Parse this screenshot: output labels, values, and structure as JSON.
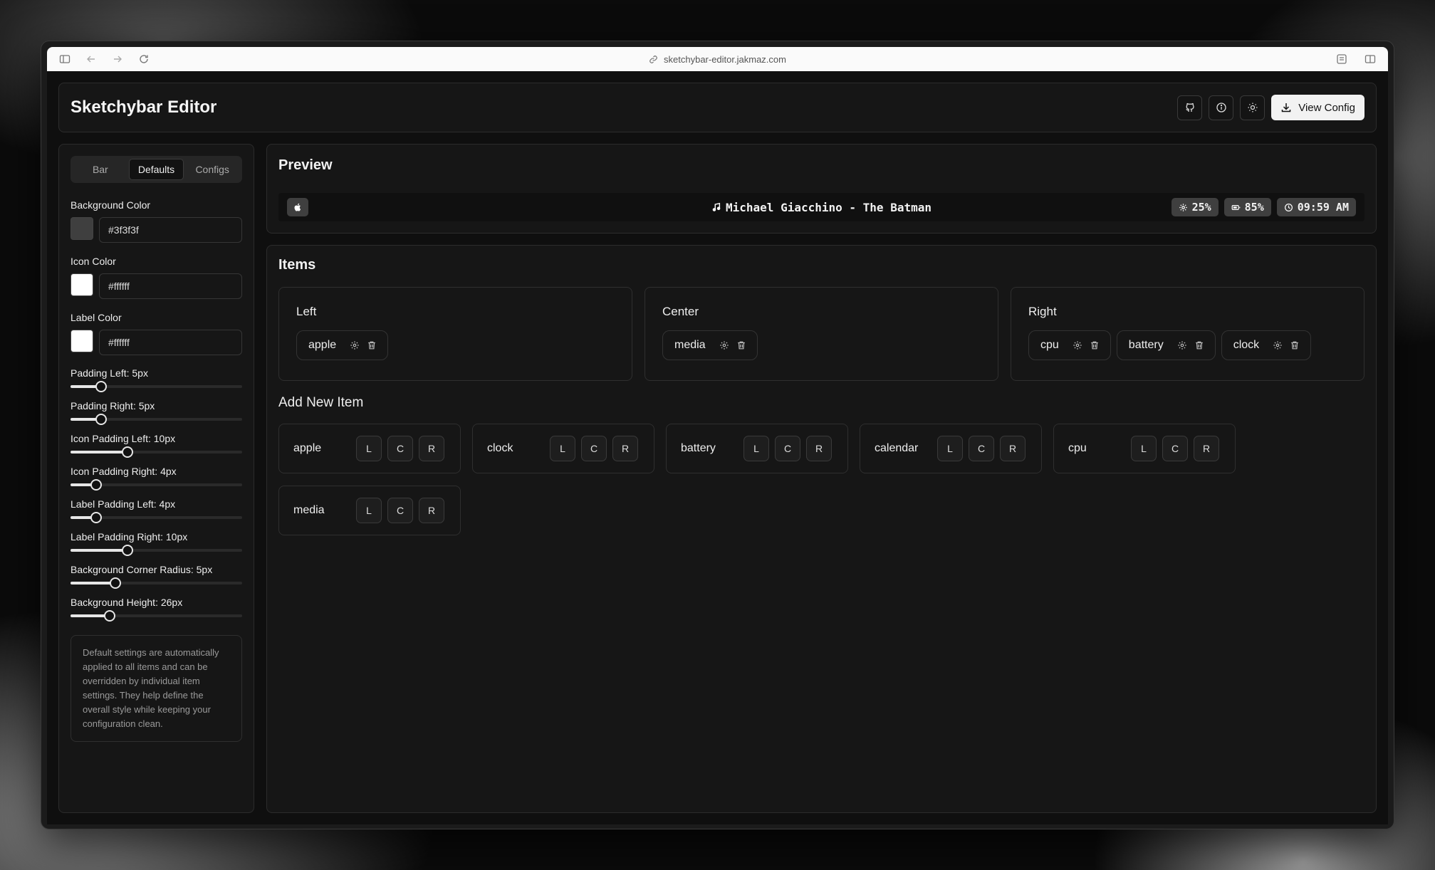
{
  "browser": {
    "url": "sketchybar-editor.jakmaz.com"
  },
  "header": {
    "title": "Sketchybar Editor",
    "view_config_label": "View Config"
  },
  "sidebar": {
    "tabs": [
      {
        "label": "Bar",
        "active": false
      },
      {
        "label": "Defaults",
        "active": true
      },
      {
        "label": "Configs",
        "active": false
      }
    ],
    "colors": [
      {
        "label": "Background Color",
        "value": "#3f3f3f",
        "swatch": "#3f3f3f"
      },
      {
        "label": "Icon Color",
        "value": "#ffffff",
        "swatch": "#ffffff"
      },
      {
        "label": "Label Color",
        "value": "#ffffff",
        "swatch": "#ffffff"
      }
    ],
    "sliders": [
      {
        "label": "Padding Left: 5px",
        "fraction": 0.18
      },
      {
        "label": "Padding Right: 5px",
        "fraction": 0.18
      },
      {
        "label": "Icon Padding Left: 10px",
        "fraction": 0.33
      },
      {
        "label": "Icon Padding Right: 4px",
        "fraction": 0.15
      },
      {
        "label": "Label Padding Left: 4px",
        "fraction": 0.15
      },
      {
        "label": "Label Padding Right: 10px",
        "fraction": 0.33
      },
      {
        "label": "Background Corner Radius: 5px",
        "fraction": 0.26
      },
      {
        "label": "Background Height: 26px",
        "fraction": 0.23
      }
    ],
    "note": "Default settings are automatically applied to all items and can be overridden by individual item settings. They help define the overall style while keeping your configuration clean."
  },
  "preview": {
    "title": "Preview",
    "media_text": "Michael Giacchino - The Batman",
    "cpu": "25%",
    "battery": "85%",
    "clock": "09:59 AM"
  },
  "items": {
    "title": "Items",
    "zones": [
      {
        "title": "Left",
        "items": [
          "apple"
        ]
      },
      {
        "title": "Center",
        "items": [
          "media"
        ]
      },
      {
        "title": "Right",
        "items": [
          "cpu",
          "battery",
          "clock"
        ]
      }
    ],
    "add_title": "Add New Item",
    "add_items": [
      "apple",
      "clock",
      "battery",
      "calendar",
      "cpu",
      "media"
    ],
    "position_buttons": [
      "L",
      "C",
      "R"
    ]
  }
}
